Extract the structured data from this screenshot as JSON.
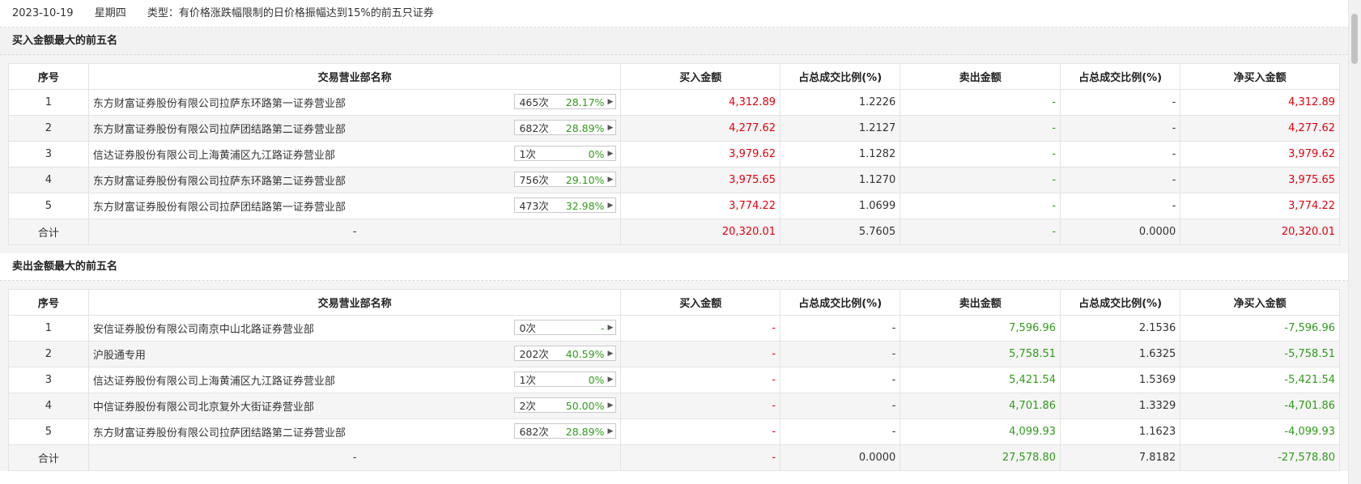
{
  "header": {
    "date": "2023-10-19",
    "weekday": "星期四",
    "type_label": "类型：有价格涨跌幅限制的日价格振幅达到15%的前五只证券"
  },
  "columns": [
    "序号",
    "交易营业部名称",
    "买入金额",
    "占总成交比例(%)",
    "卖出金额",
    "占总成交比例(%)",
    "净买入金额"
  ],
  "buy_section": {
    "title": "买入金额最大的前五名",
    "rows": [
      {
        "no": "1",
        "name": "东方财富证券股份有限公司拉萨东环路第一证券营业部",
        "count": "465次",
        "rate": "28.17%",
        "buy": "4,312.89",
        "buy_pct": "1.2226",
        "sell": "-",
        "sell_pct": "-",
        "net": "4,312.89"
      },
      {
        "no": "2",
        "name": "东方财富证券股份有限公司拉萨团结路第二证券营业部",
        "count": "682次",
        "rate": "28.89%",
        "buy": "4,277.62",
        "buy_pct": "1.2127",
        "sell": "-",
        "sell_pct": "-",
        "net": "4,277.62"
      },
      {
        "no": "3",
        "name": "信达证券股份有限公司上海黄浦区九江路证券营业部",
        "count": "1次",
        "rate": "0%",
        "buy": "3,979.62",
        "buy_pct": "1.1282",
        "sell": "-",
        "sell_pct": "-",
        "net": "3,979.62"
      },
      {
        "no": "4",
        "name": "东方财富证券股份有限公司拉萨东环路第二证券营业部",
        "count": "756次",
        "rate": "29.10%",
        "buy": "3,975.65",
        "buy_pct": "1.1270",
        "sell": "-",
        "sell_pct": "-",
        "net": "3,975.65"
      },
      {
        "no": "5",
        "name": "东方财富证券股份有限公司拉萨团结路第一证券营业部",
        "count": "473次",
        "rate": "32.98%",
        "buy": "3,774.22",
        "buy_pct": "1.0699",
        "sell": "-",
        "sell_pct": "-",
        "net": "3,774.22"
      }
    ],
    "total": {
      "label": "合计",
      "name": "-",
      "buy": "20,320.01",
      "buy_pct": "5.7605",
      "sell": "-",
      "sell_pct": "0.0000",
      "net": "20,320.01"
    }
  },
  "sell_section": {
    "title": "卖出金额最大的前五名",
    "rows": [
      {
        "no": "1",
        "name": "安信证券股份有限公司南京中山北路证券营业部",
        "count": "0次",
        "rate": "-",
        "buy": "-",
        "buy_pct": "-",
        "sell": "7,596.96",
        "sell_pct": "2.1536",
        "net": "-7,596.96"
      },
      {
        "no": "2",
        "name": "沪股通专用",
        "count": "202次",
        "rate": "40.59%",
        "buy": "-",
        "buy_pct": "-",
        "sell": "5,758.51",
        "sell_pct": "1.6325",
        "net": "-5,758.51"
      },
      {
        "no": "3",
        "name": "信达证券股份有限公司上海黄浦区九江路证券营业部",
        "count": "1次",
        "rate": "0%",
        "buy": "-",
        "buy_pct": "-",
        "sell": "5,421.54",
        "sell_pct": "1.5369",
        "net": "-5,421.54"
      },
      {
        "no": "4",
        "name": "中信证券股份有限公司北京复外大街证券营业部",
        "count": "2次",
        "rate": "50.00%",
        "buy": "-",
        "buy_pct": "-",
        "sell": "4,701.86",
        "sell_pct": "1.3329",
        "net": "-4,701.86"
      },
      {
        "no": "5",
        "name": "东方财富证券股份有限公司拉萨团结路第二证券营业部",
        "count": "682次",
        "rate": "28.89%",
        "buy": "-",
        "buy_pct": "-",
        "sell": "4,099.93",
        "sell_pct": "1.1623",
        "net": "-4,099.93"
      }
    ],
    "total": {
      "label": "合计",
      "name": "-",
      "buy": "-",
      "buy_pct": "0.0000",
      "sell": "27,578.80",
      "sell_pct": "7.8182",
      "net": "-27,578.80"
    }
  },
  "colors": {
    "up": "#e4000f",
    "down": "#319b1b"
  }
}
